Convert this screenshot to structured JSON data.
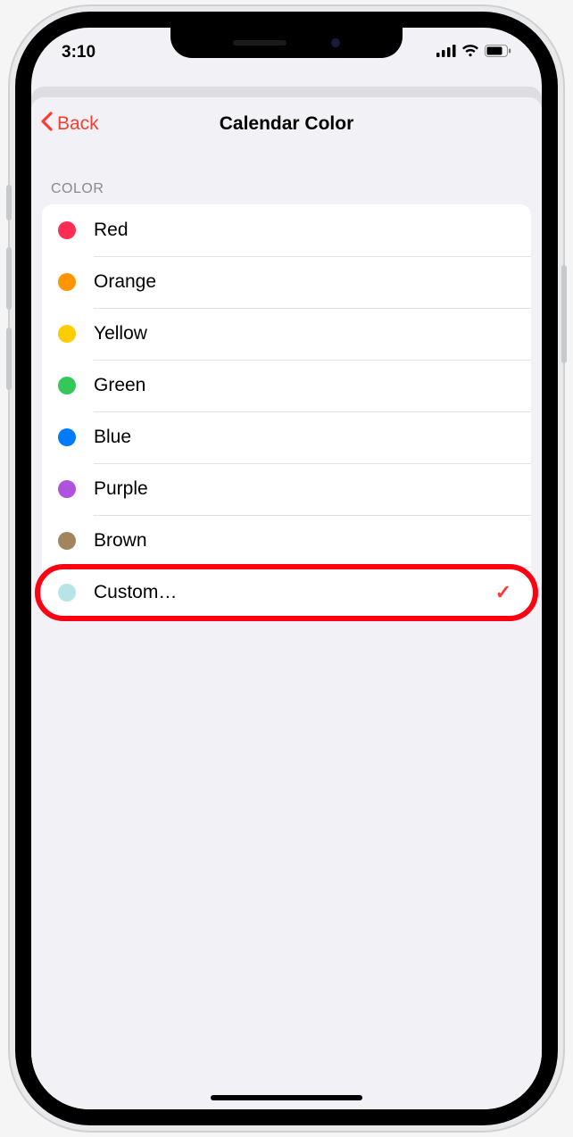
{
  "status": {
    "time": "3:10"
  },
  "nav": {
    "back_label": "Back",
    "title": "Calendar Color"
  },
  "section": {
    "header": "COLOR"
  },
  "colors": [
    {
      "label": "Red",
      "hex": "#ff2d55",
      "selected": false
    },
    {
      "label": "Orange",
      "hex": "#ff9500",
      "selected": false
    },
    {
      "label": "Yellow",
      "hex": "#ffcc00",
      "selected": false
    },
    {
      "label": "Green",
      "hex": "#34c759",
      "selected": false
    },
    {
      "label": "Blue",
      "hex": "#007aff",
      "selected": false
    },
    {
      "label": "Purple",
      "hex": "#af52de",
      "selected": false
    },
    {
      "label": "Brown",
      "hex": "#a2845e",
      "selected": false
    },
    {
      "label": "Custom…",
      "hex": "#b7e4e7",
      "selected": true
    }
  ],
  "highlight_index": 7,
  "accent": "#ff3b30"
}
